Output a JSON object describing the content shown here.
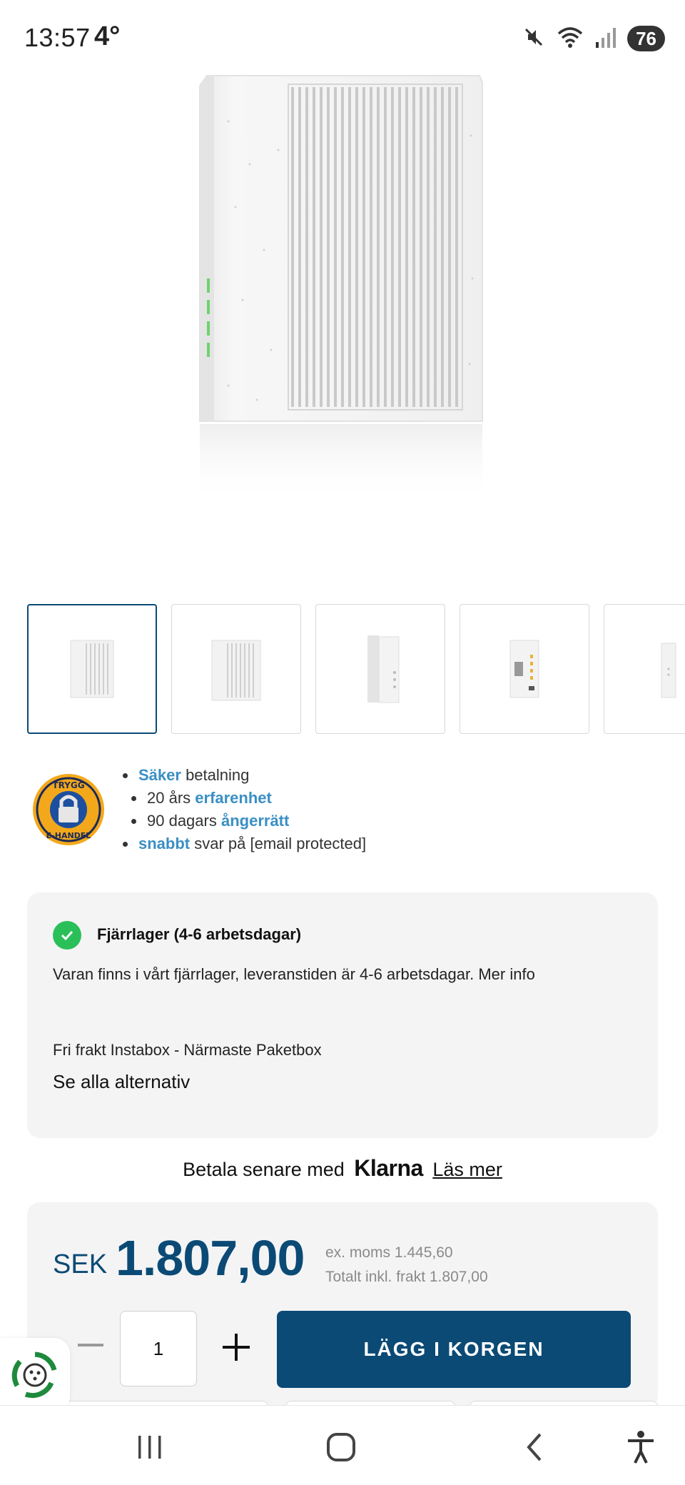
{
  "status_bar": {
    "time": "13:57",
    "temperature": "4°",
    "battery": "76",
    "icons": [
      "mute-icon",
      "wifi-icon",
      "signal-icon",
      "battery-icon"
    ]
  },
  "product": {
    "image_alt": "white router",
    "thumbnails": [
      {
        "name": "thumbnail-1",
        "active": true
      },
      {
        "name": "thumbnail-2",
        "active": false
      },
      {
        "name": "thumbnail-3",
        "active": false
      },
      {
        "name": "thumbnail-4",
        "active": false
      },
      {
        "name": "thumbnail-5",
        "active": false
      }
    ]
  },
  "trust": {
    "badge_text_top": "TRYGG",
    "badge_text_bottom": "E-HANDEL",
    "items": [
      {
        "highlight": "Säker",
        "text": " betalning"
      },
      {
        "pre": "20 års ",
        "highlight": "erfarenhet"
      },
      {
        "pre": "90 dagars ",
        "highlight": "ångerrätt"
      },
      {
        "highlight": "snabbt",
        "text": " svar på [email protected]"
      }
    ]
  },
  "stock": {
    "title": "Fjärrlager (4-6 arbetsdagar)",
    "description": "Varan finns i vårt fjärrlager, leveranstiden är 4-6 arbetsdagar. Mer info",
    "shipping": "Fri frakt Instabox - Närmaste Paketbox",
    "link": "Se alla alternativ"
  },
  "klarna": {
    "prefix": "Betala senare med",
    "brand": "Klarna",
    "link": "Läs mer"
  },
  "price": {
    "currency": "SEK",
    "amount": "1.807,00",
    "ex_vat": "ex. moms 1.445,60",
    "total": "Totalt inkl. frakt 1.807,00"
  },
  "cart": {
    "quantity": "1",
    "add_label": "LÄGG I KORGEN"
  },
  "colors": {
    "primary": "#0b4a75",
    "link": "#3a8fc4",
    "success": "#2bbf5a",
    "panel": "#f4f4f5"
  }
}
